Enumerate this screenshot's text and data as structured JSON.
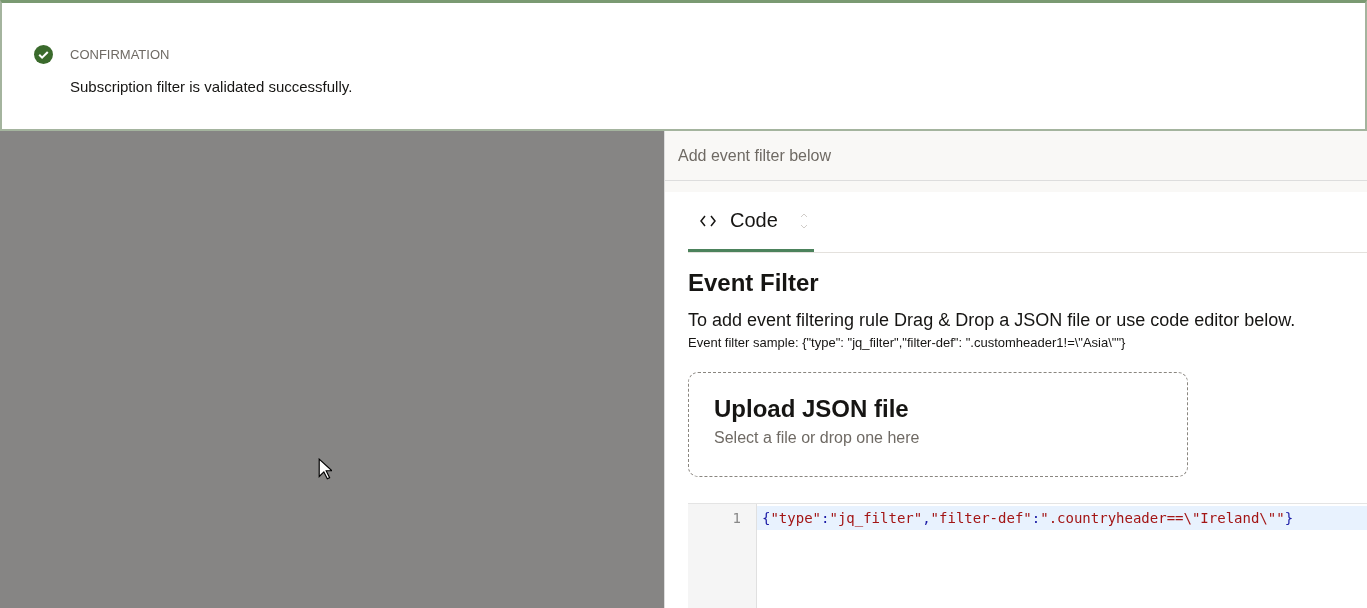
{
  "notification": {
    "kind": "confirmation",
    "title": "CONFIRMATION",
    "message": "Subscription filter is validated successfully."
  },
  "panel": {
    "header": "Add event filter below",
    "tabs": [
      {
        "label": "Code",
        "selected": true
      }
    ],
    "heading": "Event Filter",
    "description": "To add event filtering rule Drag & Drop a JSON file or use code editor below.",
    "sample": "Event filter sample: {\"type\": \"jq_filter\",\"filter-def\": \".customheader1!=\\\"Asia\\\"\"}",
    "upload": {
      "title": "Upload JSON file",
      "subtitle": "Select a file or drop one here"
    },
    "editor": {
      "lines": [
        {
          "number": "1",
          "selected": true,
          "tokens": [
            {
              "kind": "punct",
              "text": "{"
            },
            {
              "kind": "string",
              "text": "\"type\""
            },
            {
              "kind": "punct",
              "text": ":"
            },
            {
              "kind": "string",
              "text": "\"jq_filter\""
            },
            {
              "kind": "punct",
              "text": ","
            },
            {
              "kind": "string",
              "text": "\"filter-def\""
            },
            {
              "kind": "punct",
              "text": ":"
            },
            {
              "kind": "string",
              "text": "\".countryheader==\\\"Ireland\\\"\""
            },
            {
              "kind": "punct",
              "text": "}"
            }
          ]
        }
      ]
    }
  }
}
